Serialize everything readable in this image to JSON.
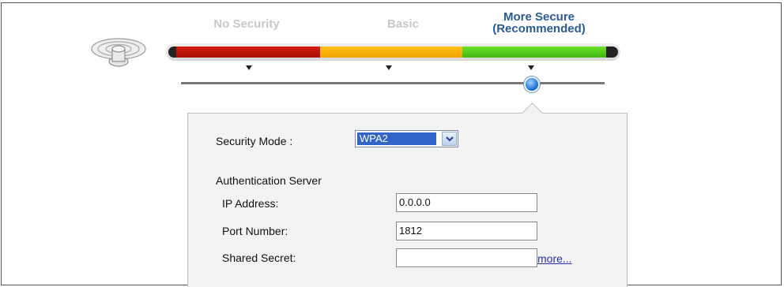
{
  "security_levels": [
    {
      "label": "No Security",
      "active": false
    },
    {
      "label": "Basic",
      "active": false
    },
    {
      "label": "More Secure",
      "label_line2": "(Recommended)",
      "active": true
    }
  ],
  "bar_colors": {
    "none": "#c3140a",
    "basic": "#f8b20c",
    "secure": "#55c91c"
  },
  "slider": {
    "selected_level": "More Secure",
    "selected_index": 2
  },
  "form": {
    "security_mode_label": "Security Mode :",
    "security_mode_value": "WPA2",
    "auth_server_heading": "Authentication Server",
    "ip_address_label": "IP Address:",
    "ip_address_value": "0.0.0.0",
    "port_number_label": "Port Number:",
    "port_number_value": "1812",
    "shared_secret_label": "Shared Secret:",
    "shared_secret_value": "",
    "more_link": "more..."
  },
  "icons": {
    "router": "wireless-router-icon",
    "dropdown": "chevron-down-icon"
  }
}
